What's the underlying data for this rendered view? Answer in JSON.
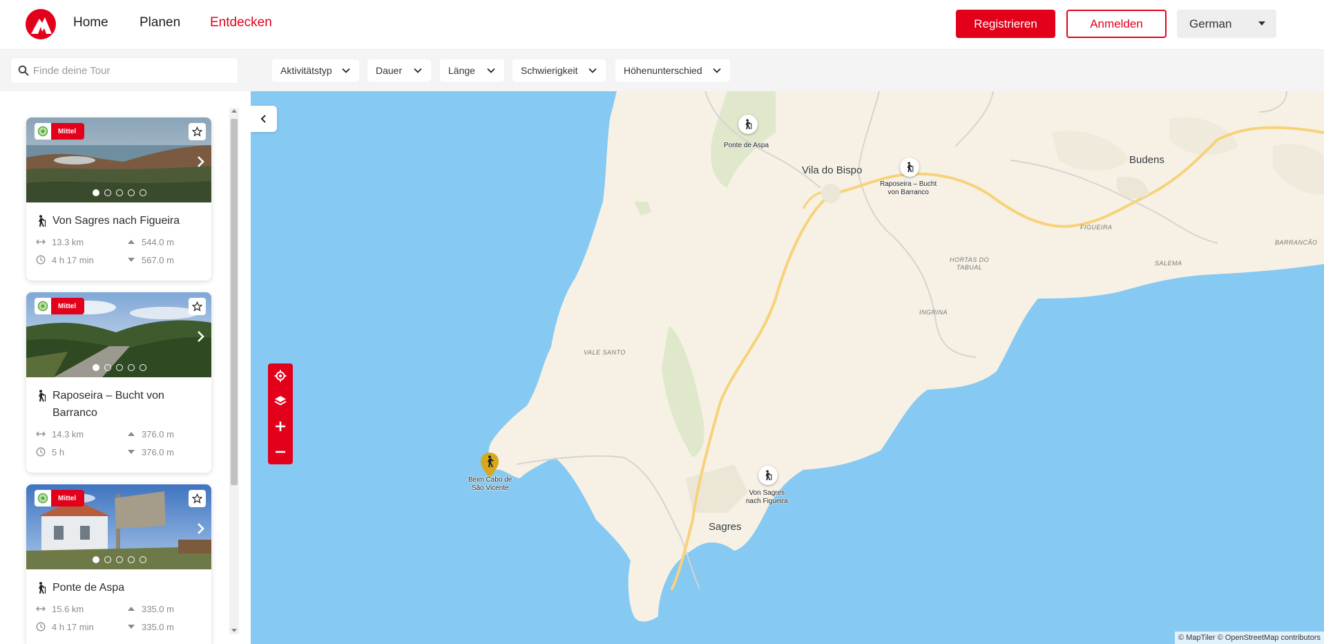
{
  "nav": {
    "home": "Home",
    "plan": "Planen",
    "discover": "Entdecken",
    "register": "Registrieren",
    "login": "Anmelden",
    "language": "German"
  },
  "search": {
    "placeholder": "Finde deine Tour"
  },
  "filters": {
    "activity": "Aktivitätstyp",
    "duration": "Dauer",
    "length": "Länge",
    "difficulty": "Schwierigkeit",
    "elevation": "Höhenunterschied"
  },
  "tours": [
    {
      "badge": "Mittel",
      "title": "Von Sagres nach Figueira",
      "distance": "13.3 km",
      "duration": "4 h 17 min",
      "ascent": "544.0 m",
      "descent": "567.0 m",
      "images": 5,
      "active_image": 1
    },
    {
      "badge": "Mittel",
      "title": "Raposeira – Bucht von Barranco",
      "distance": "14.3 km",
      "duration": "5 h",
      "ascent": "376.0 m",
      "descent": "376.0 m",
      "images": 5,
      "active_image": 1
    },
    {
      "badge": "Mittel",
      "title": "Ponte de Aspa",
      "distance": "15.6 km",
      "duration": "4 h 17 min",
      "ascent": "335.0 m",
      "descent": "335.0 m",
      "images": 5,
      "active_image": 1
    }
  ],
  "map": {
    "places": {
      "vila_do_bispo": "Vila do Bispo",
      "budens": "Budens",
      "sagres": "Sagres"
    },
    "localities": {
      "figueira": "FIGUEIRA",
      "barranco": "BARRANCÃO",
      "salema": "SALEMA",
      "hortas_line1": "HORTAS DO",
      "hortas_line2": "TABUAL",
      "ingrina": "INGRINA",
      "vale_santo": "VALE SANTO"
    },
    "markers": {
      "ponte_de_aspa": "Ponte de Aspa",
      "raposeira_line1": "Raposeira – Bucht",
      "raposeira_line2": "von Barranco",
      "sagres_line1": "Von Sagres",
      "sagres_line2": "nach Figueira",
      "cabo_line1": "Beim Cabo de",
      "cabo_line2": "São Vicente"
    },
    "attribution": "© MapTiler © OpenStreetMap contributors"
  },
  "colors": {
    "brand": "#e3001b",
    "sea": "#86c9f2",
    "land": "#f6f1e4"
  }
}
